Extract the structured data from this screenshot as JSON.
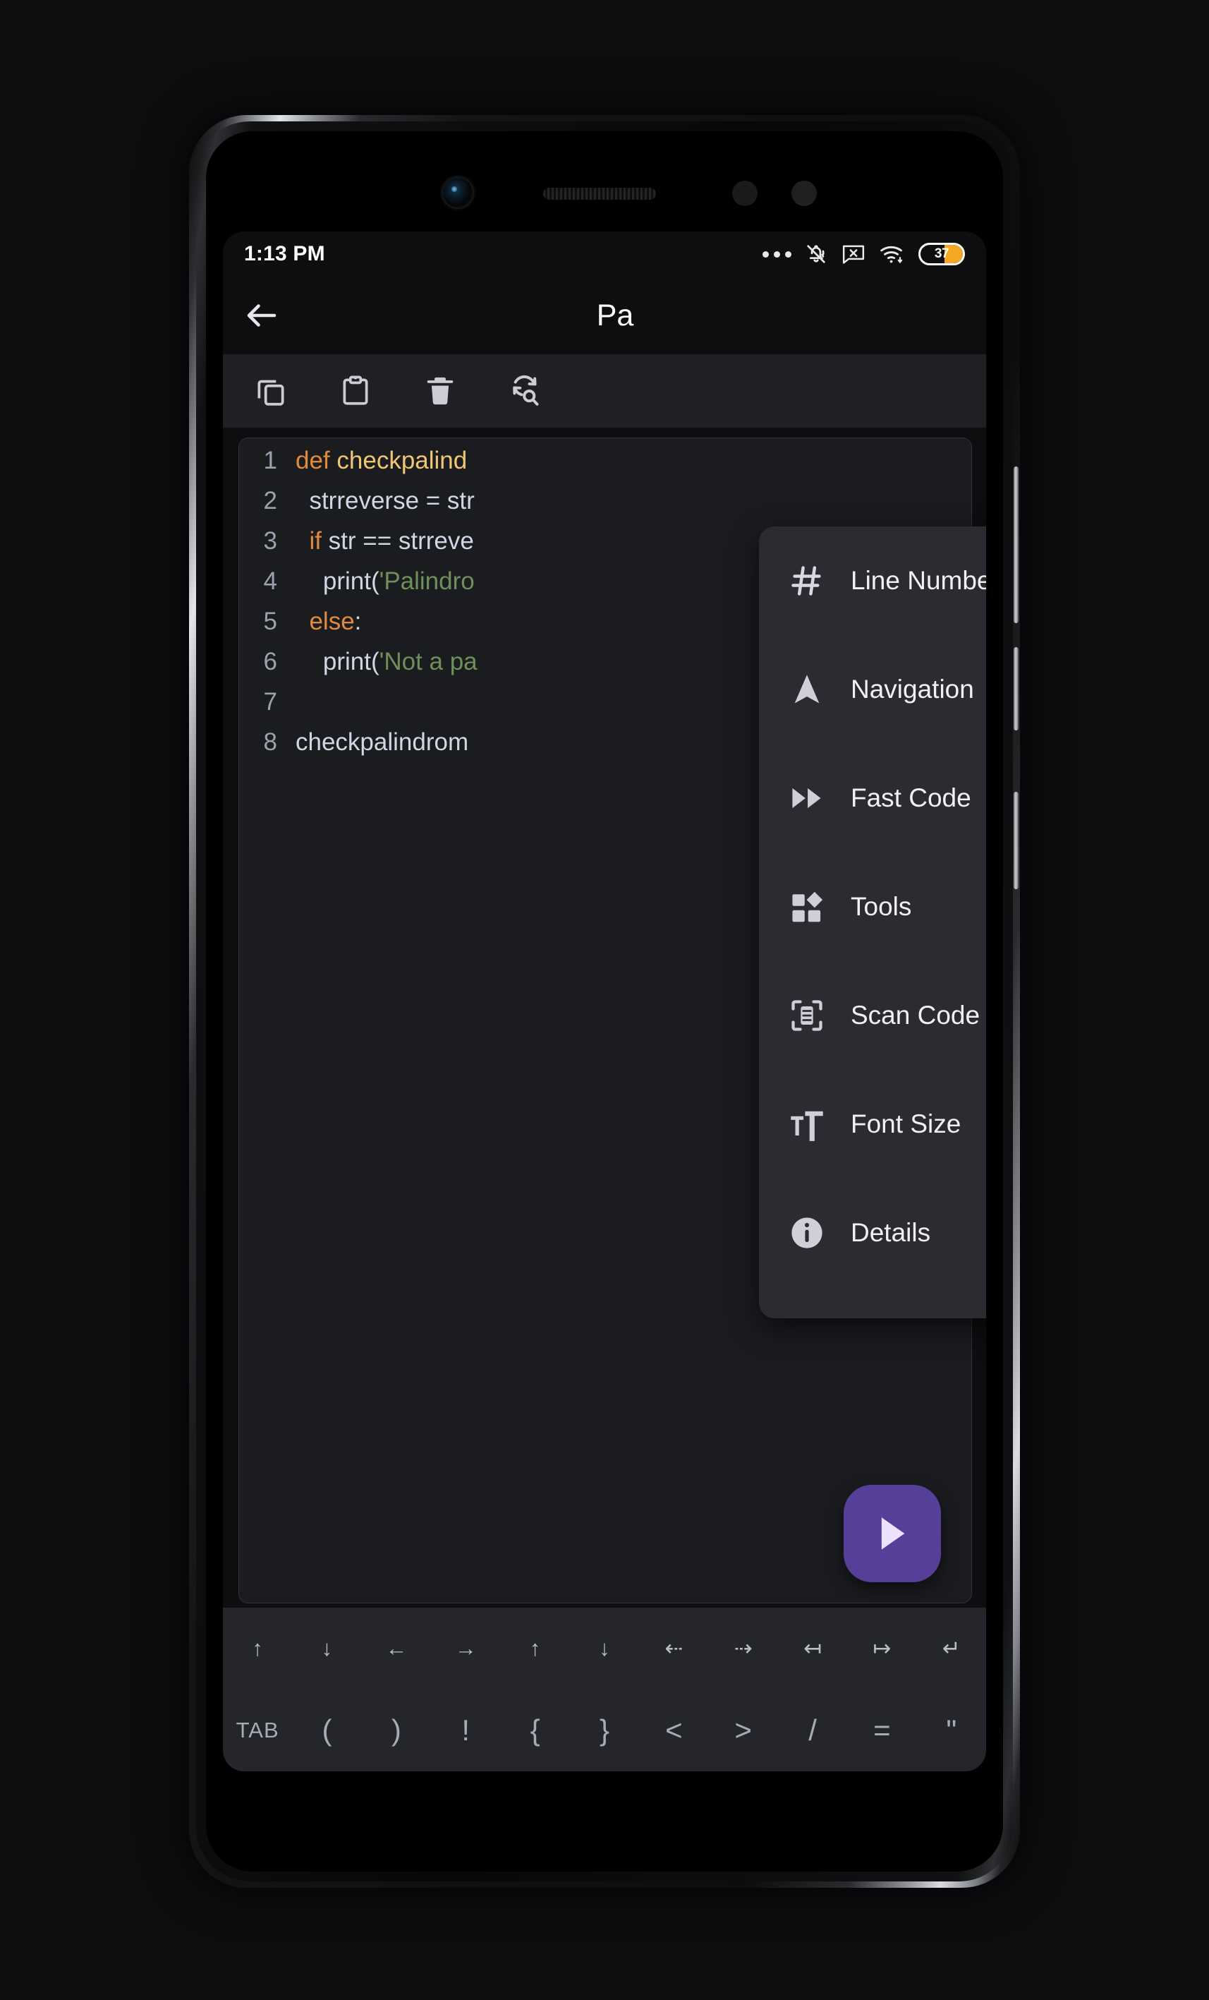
{
  "status_bar": {
    "time": "1:13 PM",
    "battery_percent": "37",
    "icons": [
      "more-dots-icon",
      "bell-muted-icon",
      "sms-blocked-icon",
      "wifi-icon",
      "battery-icon"
    ]
  },
  "app_bar": {
    "back_label": "back-arrow",
    "title": "Pa"
  },
  "edit_toolbar": {
    "items": [
      {
        "name": "copy-icon",
        "label": "Copy"
      },
      {
        "name": "paste-icon",
        "label": "Paste"
      },
      {
        "name": "delete-icon",
        "label": "Delete"
      },
      {
        "name": "find-replace-icon",
        "label": "Find and Replace"
      }
    ]
  },
  "editor": {
    "language": "python",
    "lines": [
      {
        "n": "1",
        "tokens": [
          {
            "t": "def ",
            "c": "k"
          },
          {
            "t": "checkpalind",
            "c": "fn"
          }
        ]
      },
      {
        "n": "2",
        "tokens": [
          {
            "t": "  strreverse = str",
            "c": "code"
          }
        ]
      },
      {
        "n": "3",
        "tokens": [
          {
            "t": "  ",
            "c": "code"
          },
          {
            "t": "if",
            "c": "k"
          },
          {
            "t": " str == strreve",
            "c": "code"
          }
        ]
      },
      {
        "n": "4",
        "tokens": [
          {
            "t": "    print(",
            "c": "code"
          },
          {
            "t": "'Palindro",
            "c": "s"
          }
        ]
      },
      {
        "n": "5",
        "tokens": [
          {
            "t": "  ",
            "c": "code"
          },
          {
            "t": "else",
            "c": "k"
          },
          {
            "t": ":",
            "c": "code"
          }
        ]
      },
      {
        "n": "6",
        "tokens": [
          {
            "t": "    print(",
            "c": "code"
          },
          {
            "t": "'Not a pa",
            "c": "s"
          }
        ]
      },
      {
        "n": "7",
        "tokens": [
          {
            "t": "",
            "c": "code"
          }
        ]
      },
      {
        "n": "8",
        "tokens": [
          {
            "t": "checkpalindrom",
            "c": "code"
          }
        ]
      }
    ]
  },
  "run_button": {
    "name": "run-button",
    "icon": "play-icon",
    "color": "#553f98"
  },
  "key_toolbar": {
    "row1": [
      "↑",
      "↓",
      "←",
      "→",
      "↑",
      "↓",
      "⇠",
      "⇢",
      "↤",
      "↦",
      "↵"
    ],
    "row1_names": [
      "arrow-up",
      "arrow-down",
      "arrow-left",
      "arrow-right",
      "page-up",
      "page-down",
      "word-left",
      "word-right",
      "line-start",
      "line-end",
      "enter"
    ],
    "row2": [
      "TAB",
      "(",
      ")",
      "!",
      "{",
      "}",
      "<",
      ">",
      "/",
      "=",
      "\""
    ],
    "row2_names": [
      "tab-key",
      "paren-open",
      "paren-close",
      "exclamation",
      "brace-open",
      "brace-close",
      "angle-open",
      "angle-close",
      "slash",
      "equals",
      "quote"
    ]
  },
  "menu": {
    "items": [
      {
        "label": "Line Number",
        "icon": "hash-icon",
        "checkbox": true,
        "checked": true
      },
      {
        "label": "Navigation",
        "icon": "navigation-icon",
        "checkbox": true,
        "checked": true
      },
      {
        "label": "Fast Code",
        "icon": "fast-forward-icon",
        "checkbox": true,
        "checked": true
      },
      {
        "label": "Tools",
        "icon": "tools-grid-icon",
        "checkbox": true,
        "checked": true
      },
      {
        "label": "Scan Code",
        "icon": "scan-code-icon",
        "checkbox": false,
        "checked": false
      },
      {
        "label": "Font Size",
        "icon": "font-size-icon",
        "checkbox": false,
        "checked": false
      },
      {
        "label": "Details",
        "icon": "info-icon",
        "checkbox": false,
        "checked": false
      }
    ],
    "checkbox_color": "#cdb4fe",
    "check_color": "#4a2f8f"
  },
  "theme": {
    "page_bg": "#0e0e11",
    "screen_bg": "#0e0e11",
    "toolbar_bg": "#1f2024",
    "code_bg": "#1b1c20",
    "menu_bg": "#2a2c31",
    "accent": "#553f98"
  }
}
